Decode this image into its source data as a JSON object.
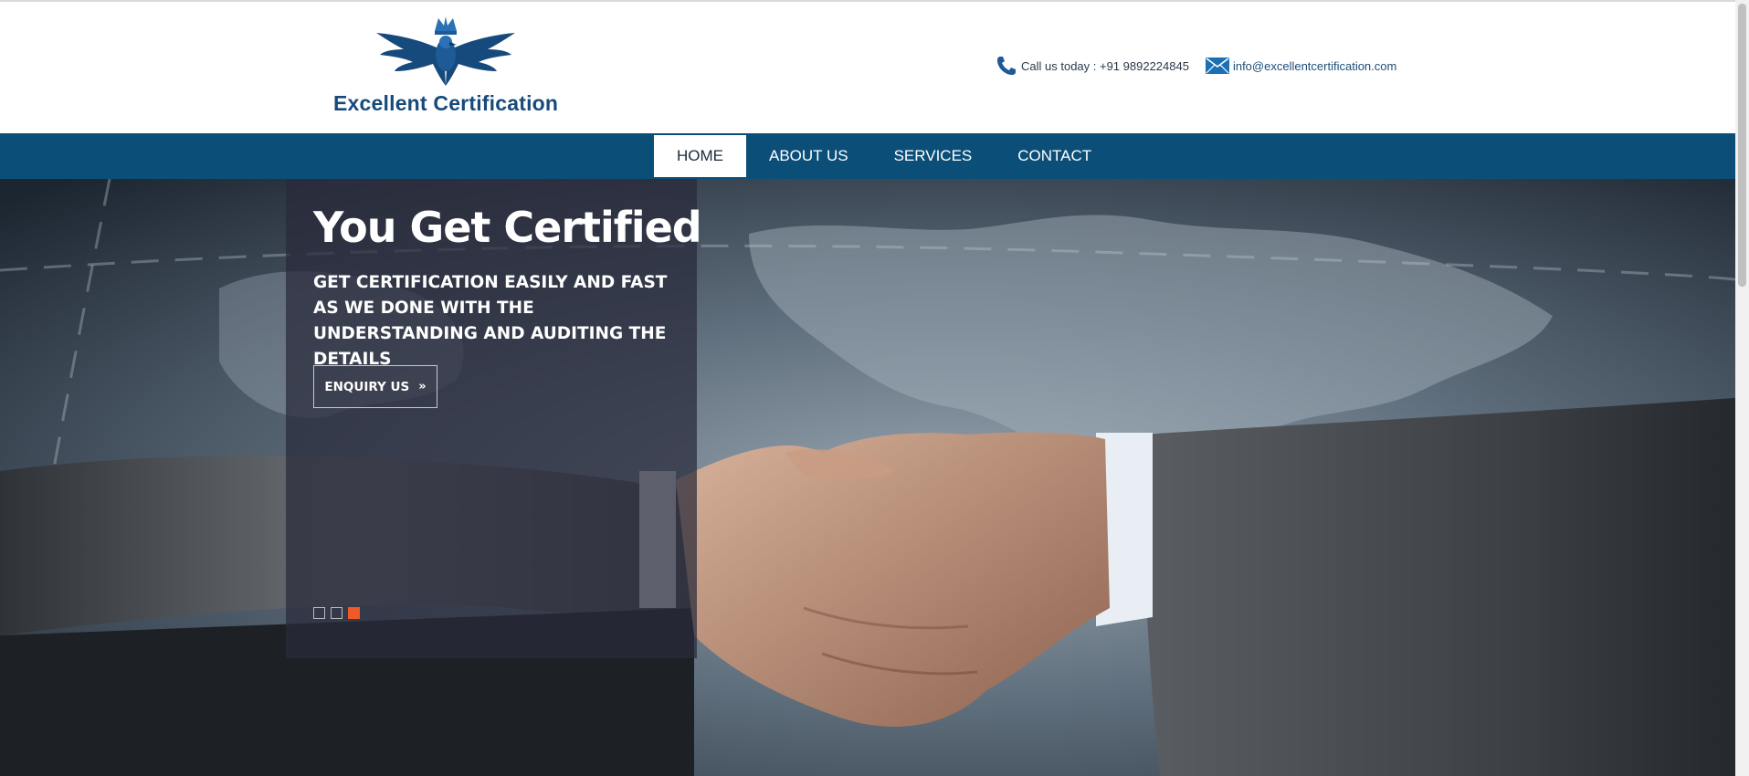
{
  "header": {
    "logo_text": "Excellent Certification",
    "phone_text": "Call us today : +91 9892224845",
    "email_text": "info@excellentcertification.com",
    "icons": [
      "phone-icon",
      "mail-icon",
      "eagle-crown-logo"
    ]
  },
  "nav": {
    "items": [
      {
        "label": "HOME",
        "active": true
      },
      {
        "label": "ABOUT US",
        "active": false
      },
      {
        "label": "SERVICES",
        "active": false
      },
      {
        "label": "CONTACT",
        "active": false
      }
    ]
  },
  "hero": {
    "title": "You Get Certified",
    "subtitle": "GET CERTIFICATION EASILY AND FAST AS WE DONE WITH THE UNDERSTANDING AND AUDITING THE DETAILS",
    "button_label": "ENQUIRY US",
    "button_icon": "double-chevron-right-icon",
    "slider_count": 3,
    "slider_active_index": 3
  },
  "colors": {
    "brand_blue": "#0b4f79",
    "logo_blue": "#174a7c",
    "accent_orange": "#ef5a28"
  }
}
